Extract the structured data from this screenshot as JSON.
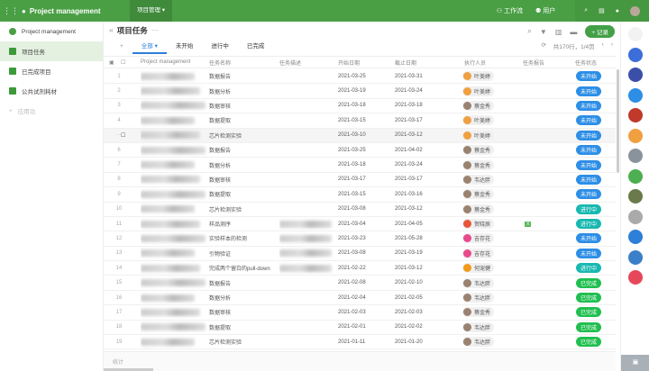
{
  "topbar": {
    "app_name": "Project management",
    "crumb": "项目管理 ▾",
    "workflow": "工作流",
    "users": "用户"
  },
  "sidebar": {
    "items": [
      "Project management",
      "项目任务",
      "已完成项目",
      "公共试剂耗材"
    ],
    "add": "应用功"
  },
  "main": {
    "title": "项目任务",
    "more": "···",
    "tabs": [
      "全部 ▾",
      "未开始",
      "进行中",
      "已完成"
    ],
    "add_record": "+ 记录",
    "pager": "共170行，1/4页",
    "footer": "统计"
  },
  "columns": [
    "Project management",
    "任务名称",
    "任务描述",
    "开始日期",
    "截止日期",
    "执行人员",
    "任务报告",
    "任务状态"
  ],
  "status_colors": {
    "未开始": "#2d8ee6",
    "进行中": "#17b8b0",
    "已完成": "#1fbf4f"
  },
  "rows": [
    {
      "n": "1",
      "name": "数据报告",
      "start": "2021-03-25",
      "end": "2021-03-31",
      "who": "叶美婷",
      "status": "未开始"
    },
    {
      "n": "2",
      "name": "数据分析",
      "start": "2021-03-19",
      "end": "2021-03-24",
      "who": "叶美婷",
      "status": "未开始"
    },
    {
      "n": "3",
      "name": "数据审核",
      "start": "2021-03-18",
      "end": "2021-03-18",
      "who": "蔡金秀",
      "status": "未开始"
    },
    {
      "n": "4",
      "name": "数据提取",
      "start": "2021-03-15",
      "end": "2021-03-17",
      "who": "叶美婷",
      "status": "未开始"
    },
    {
      "n": "···",
      "name": "芯片检测实验",
      "start": "2021-03-10",
      "end": "2021-03-12",
      "who": "叶美婷",
      "status": "未开始"
    },
    {
      "n": "6",
      "name": "数据报告",
      "start": "2021-03-25",
      "end": "2021-04-02",
      "who": "蔡金秀",
      "status": "未开始"
    },
    {
      "n": "7",
      "name": "数据分析",
      "start": "2021-03-18",
      "end": "2021-03-24",
      "who": "蔡金秀",
      "status": "未开始"
    },
    {
      "n": "8",
      "name": "数据审核",
      "start": "2021-03-17",
      "end": "2021-03-17",
      "who": "韦达胖",
      "status": "未开始"
    },
    {
      "n": "9",
      "name": "数据提取",
      "start": "2021-03-15",
      "end": "2021-03-16",
      "who": "蔡金秀",
      "status": "未开始"
    },
    {
      "n": "10",
      "name": "芯片检测实验",
      "start": "2021-03-08",
      "end": "2021-03-12",
      "who": "蔡金秀",
      "status": "进行中"
    },
    {
      "n": "11",
      "name": "样品测序",
      "start": "2021-03-04",
      "end": "2021-04-05",
      "who": "贺晓辰",
      "status": "进行中"
    },
    {
      "n": "12",
      "name": "实验样本的检测",
      "start": "2021-03-23",
      "end": "2021-05-28",
      "who": "吉存花",
      "status": "未开始"
    },
    {
      "n": "13",
      "name": "引物验证",
      "start": "2021-03-08",
      "end": "2021-03-19",
      "who": "吉存花",
      "status": "未开始"
    },
    {
      "n": "14",
      "name": "完成两个留白的pull-down",
      "start": "2021-02-22",
      "end": "2021-03-12",
      "who": "何宠健",
      "status": "进行中"
    },
    {
      "n": "15",
      "name": "数据报告",
      "start": "2021-02-08",
      "end": "2021-02-10",
      "who": "韦达胖",
      "status": "已完成"
    },
    {
      "n": "16",
      "name": "数据分析",
      "start": "2021-02-04",
      "end": "2021-02-05",
      "who": "韦达胖",
      "status": "已完成"
    },
    {
      "n": "17",
      "name": "数据审核",
      "start": "2021-02-03",
      "end": "2021-02-03",
      "who": "蔡金秀",
      "status": "已完成"
    },
    {
      "n": "18",
      "name": "数据提取",
      "start": "2021-02-01",
      "end": "2021-02-02",
      "who": "韦达胖",
      "status": "已完成"
    },
    {
      "n": "19",
      "name": "芯片检测实验",
      "start": "2021-01-11",
      "end": "2021-01-20",
      "who": "韦达胖",
      "status": "已完成"
    }
  ]
}
